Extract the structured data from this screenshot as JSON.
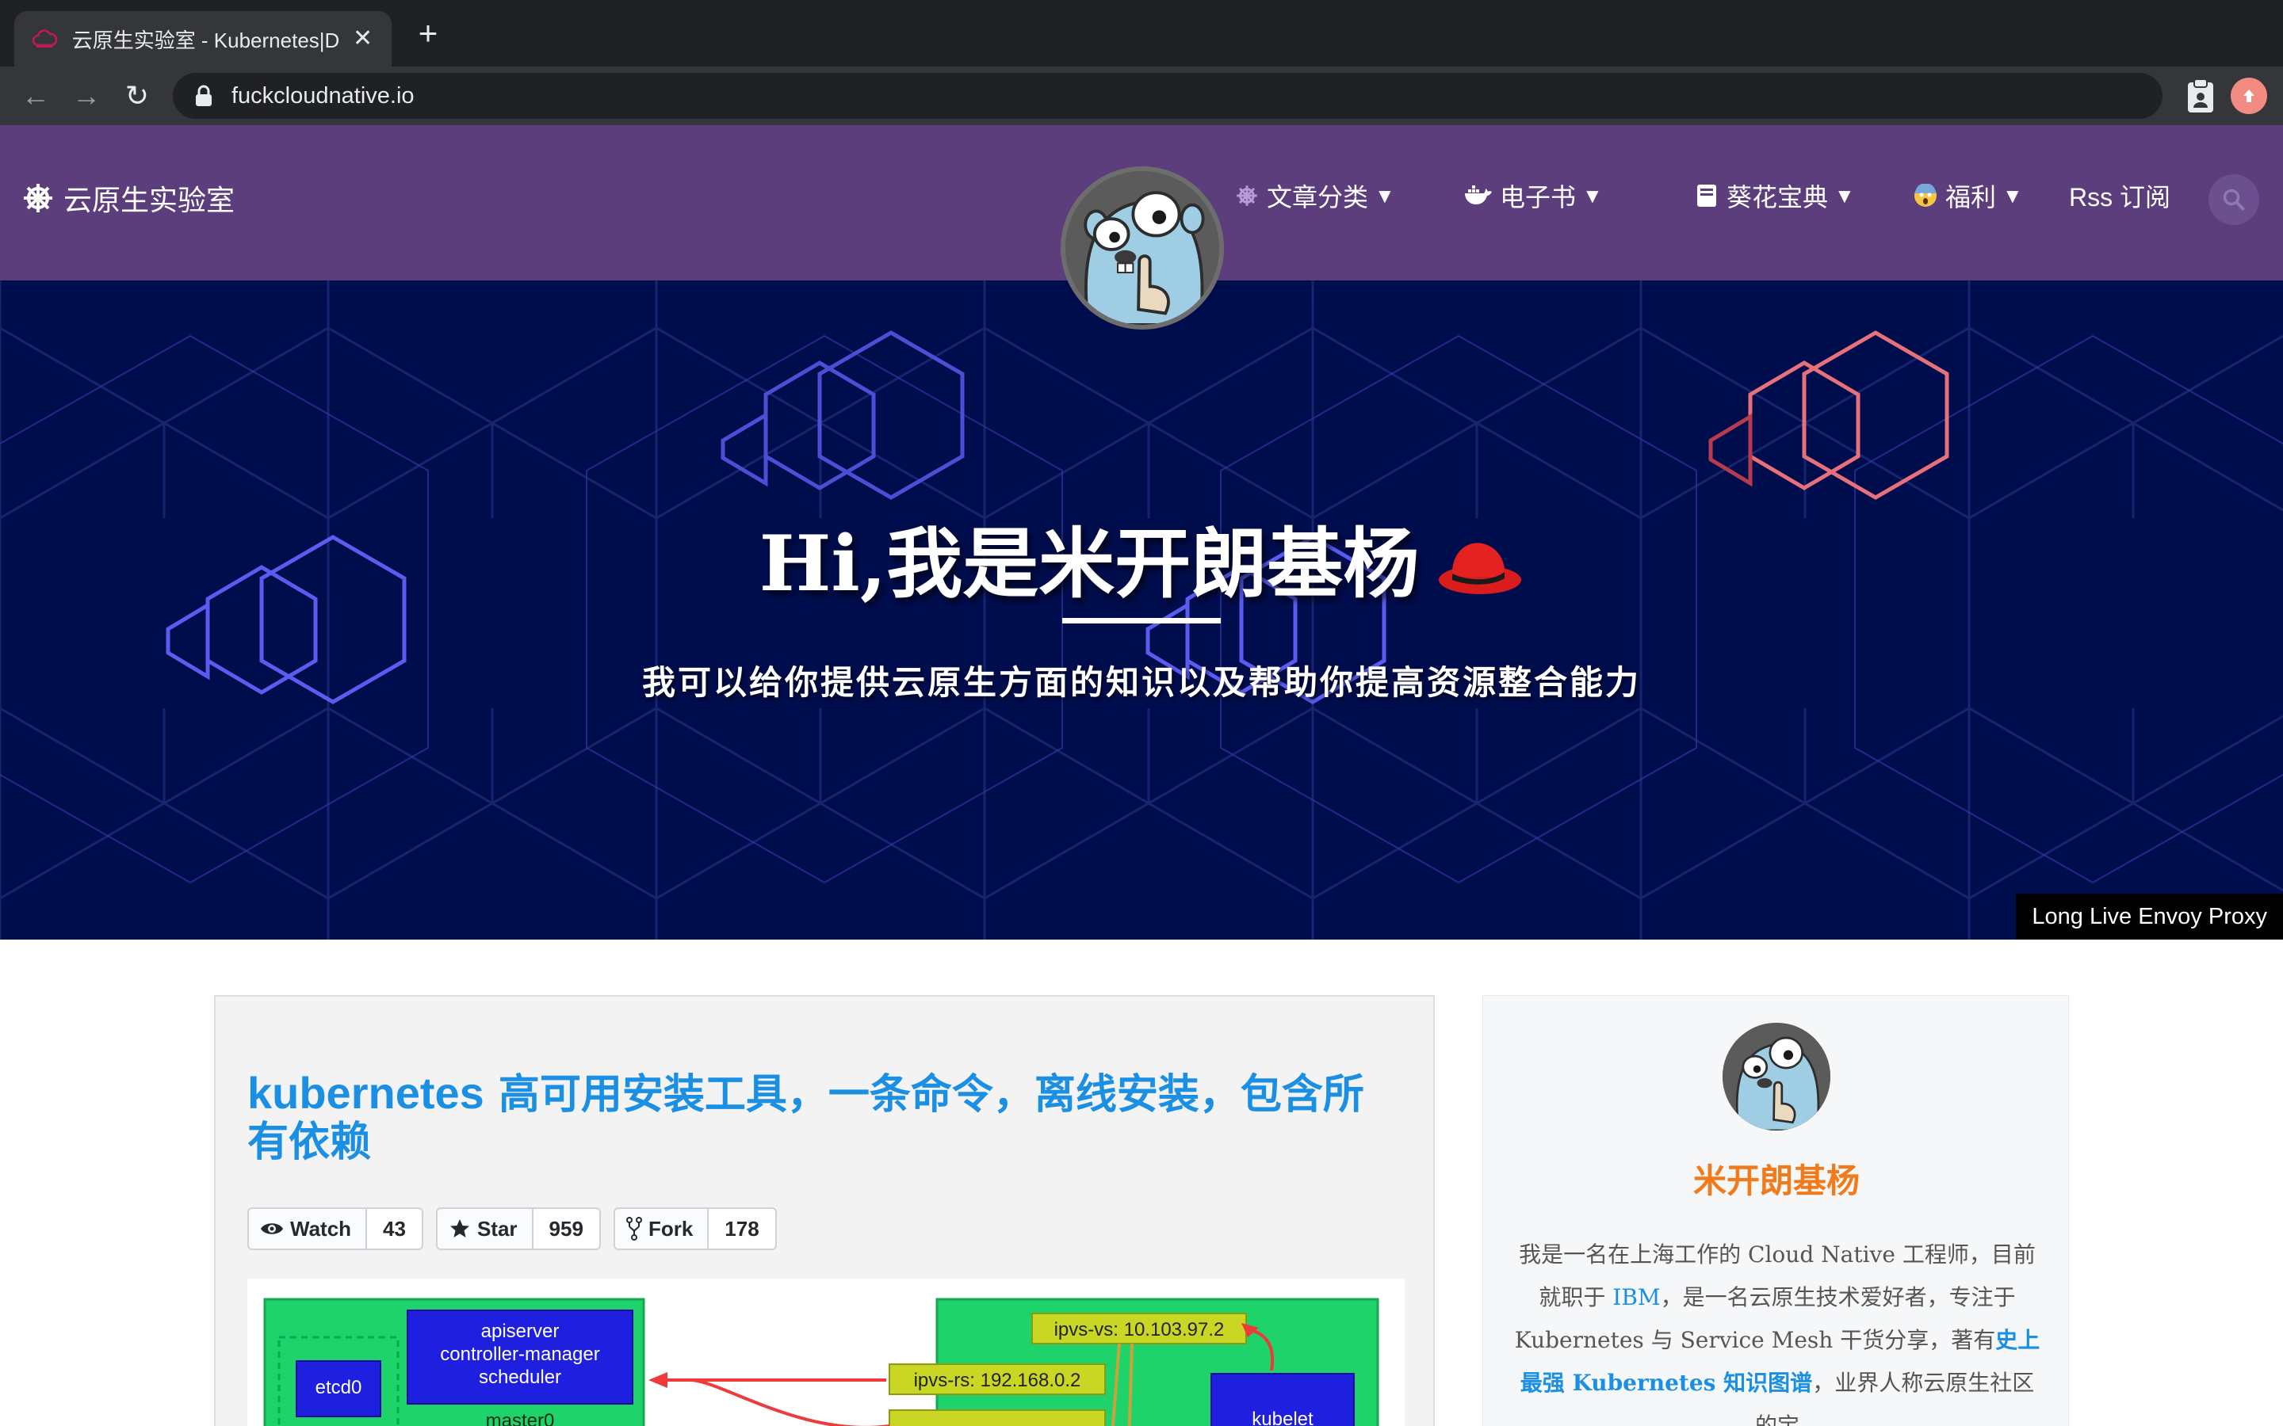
{
  "browser": {
    "tab_title": "云原生实验室 - Kubernetes|Doc",
    "tab_close": "✕",
    "new_tab": "+",
    "back": "←",
    "forward": "→",
    "reload": "↻",
    "url": "fuckcloudnative.io"
  },
  "header": {
    "brand": "云原生实验室",
    "nav": [
      {
        "label": "文章分类",
        "icon": "helm-icon",
        "caret": "▼"
      },
      {
        "label": "电子书",
        "icon": "docker-icon",
        "caret": "▼"
      },
      {
        "label": "葵花宝典",
        "icon": "book-icon",
        "caret": "▼"
      },
      {
        "label": "福利",
        "icon": "scream-emoji-icon",
        "caret": "▼"
      },
      {
        "label": "Rss 订阅",
        "icon": null,
        "caret": null
      }
    ],
    "colors": {
      "bar": "#5c3e7c",
      "search_bg": "#6c4f8e"
    }
  },
  "hero": {
    "title": "Hi,我是米开朗基杨",
    "subtitle": "我可以给你提供云原生方面的知识以及帮助你提高资源整合能力",
    "corner_tag": "Long Live Envoy Proxy",
    "colors": {
      "bg": "#000d4d",
      "hex_blue": "#5a5cf0",
      "hex_red": "#e84a5f"
    }
  },
  "post": {
    "title_en": "kubernetes",
    "title_cn": " 高可用安装工具，一条命令，离线安装，包含所有依赖",
    "github": [
      {
        "label": "Watch",
        "count": "43",
        "icon": "eye-icon"
      },
      {
        "label": "Star",
        "count": "959",
        "icon": "star-icon"
      },
      {
        "label": "Fork",
        "count": "178",
        "icon": "fork-icon"
      }
    ],
    "diagram": {
      "master_components": "apiserver\ncontroller-manager\nscheduler",
      "etcd": "etcd0",
      "master": "master0",
      "ipvs_vs": "ipvs-vs: 10.103.97.2",
      "ipvs_rs": "ipvs-rs: 192.168.0.2",
      "kubelet": "kubelet"
    }
  },
  "sidebar": {
    "name": "米开朗基杨",
    "bio_1": "我是一名在上海工作的 Cloud Native 工程师，目前就职于 ",
    "bio_link": "IBM",
    "bio_2": "，是一名云原生技术爱好者，专注于 Kubernetes 与 Service Mesh 干货分享，著有",
    "bio_bold_link": "史上最强 Kubernetes 知识图谱",
    "bio_3": "，业界人称云原生社区的宝",
    "colors": {
      "name": "#f27a1a",
      "link": "#1a8fe3"
    }
  }
}
